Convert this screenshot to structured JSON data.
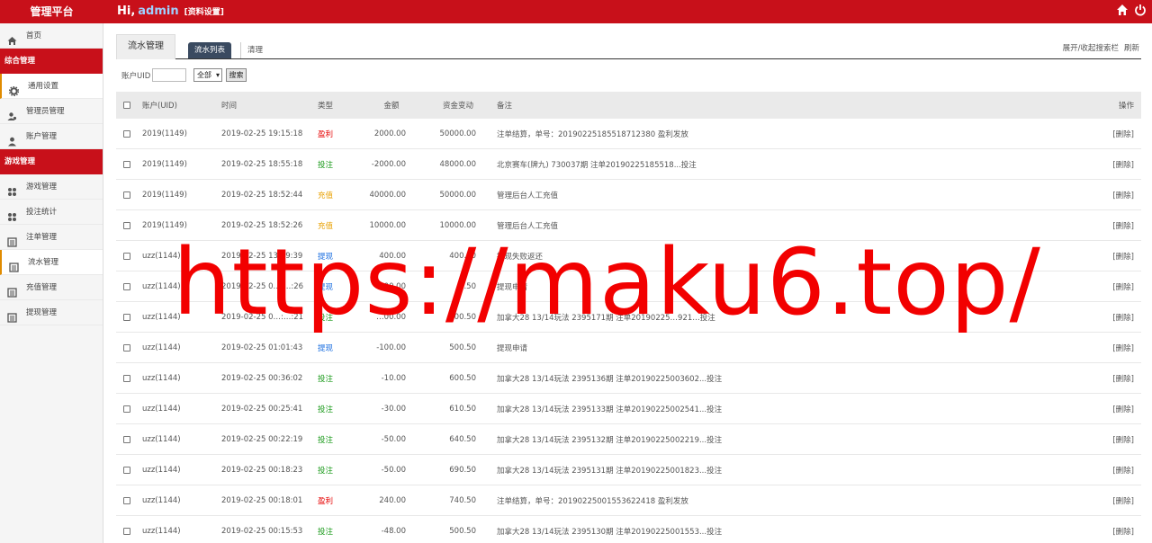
{
  "topbar": {
    "brand": "管理平台",
    "greeting": "Hi,",
    "username": "admin",
    "profile_link": "[资料设置]",
    "icons": [
      "home-icon",
      "power-icon"
    ]
  },
  "sidebar": {
    "items": [
      {
        "kind": "item",
        "label": "首页",
        "icon": "home-icon"
      },
      {
        "kind": "section",
        "label": "综合管理"
      },
      {
        "kind": "item",
        "label": "通用设置",
        "icon": "gear-icon",
        "active": true
      },
      {
        "kind": "item",
        "label": "管理员管理",
        "icon": "admin-user-icon"
      },
      {
        "kind": "item",
        "label": "账户管理",
        "icon": "user-icon"
      },
      {
        "kind": "section",
        "label": "游戏管理"
      },
      {
        "kind": "item",
        "label": "游戏管理",
        "icon": "game-icon"
      },
      {
        "kind": "item",
        "label": "投注统计",
        "icon": "stats-icon"
      },
      {
        "kind": "item",
        "label": "注单管理",
        "icon": "list-icon"
      },
      {
        "kind": "item",
        "label": "流水管理",
        "icon": "list-icon",
        "active": true
      },
      {
        "kind": "item",
        "label": "充值管理",
        "icon": "list-icon"
      },
      {
        "kind": "item",
        "label": "提现管理",
        "icon": "list-icon"
      }
    ]
  },
  "main": {
    "title_tab": "流水管理",
    "subtab_active": "流水列表",
    "subtab_clear": "清理",
    "toggle_search": "展开/收起搜索栏",
    "refresh": "刷新",
    "search": {
      "uid_label": "账户UID",
      "uid_value": "",
      "type_select": "全部",
      "search_button": "搜索"
    },
    "table": {
      "headers": {
        "uid": "账户(UID)",
        "time": "时间",
        "type": "类型",
        "amount": "金额",
        "change": "资金变动",
        "note": "备注",
        "op": "操作"
      },
      "type_colors": {
        "盈利": "#e60000",
        "投注": "#1a9a1a",
        "充值": "#e8a000",
        "提现": "#1a6ee0"
      },
      "rows": [
        {
          "uid": "2019(1149)",
          "time": "2019-02-25 19:15:18",
          "type": "盈利",
          "amount": "2000.00",
          "change": "50000.00",
          "note": "注单结算，单号：20190225185518712380 盈利发放",
          "op": "[删除]"
        },
        {
          "uid": "2019(1149)",
          "time": "2019-02-25 18:55:18",
          "type": "投注",
          "amount": "-2000.00",
          "change": "48000.00",
          "note": "北京赛车(牌九) 730037期 注单20190225185518...投注",
          "op": "[删除]"
        },
        {
          "uid": "2019(1149)",
          "time": "2019-02-25 18:52:44",
          "type": "充值",
          "amount": "40000.00",
          "change": "50000.00",
          "note": "管理后台人工充值",
          "op": "[删除]"
        },
        {
          "uid": "2019(1149)",
          "time": "2019-02-25 18:52:26",
          "type": "充值",
          "amount": "10000.00",
          "change": "10000.00",
          "note": "管理后台人工充值",
          "op": "[删除]"
        },
        {
          "uid": "uzz(1144)",
          "time": "2019-02-25 13:19:39",
          "type": "提现",
          "amount": "400.00",
          "change": "400.50",
          "note": "提现失败返还",
          "op": "[删除]"
        },
        {
          "uid": "uzz(1144)",
          "time": "2019-02-25 0…:…:26",
          "type": "提现",
          "amount": "-400.00",
          "change": "0.50",
          "note": "提现申请",
          "op": "[删除]"
        },
        {
          "uid": "uzz(1144)",
          "time": "2019-02-25 0…:…:21",
          "type": "投注",
          "amount": "…00.00",
          "change": "400.50",
          "note": "加拿大28 13/14玩法 2395171期 注单20190225…921…投注",
          "op": "[删除]"
        },
        {
          "uid": "uzz(1144)",
          "time": "2019-02-25 01:01:43",
          "type": "提现",
          "amount": "-100.00",
          "change": "500.50",
          "note": "提现申请",
          "op": "[删除]"
        },
        {
          "uid": "uzz(1144)",
          "time": "2019-02-25 00:36:02",
          "type": "投注",
          "amount": "-10.00",
          "change": "600.50",
          "note": "加拿大28 13/14玩法 2395136期 注单20190225003602...投注",
          "op": "[删除]"
        },
        {
          "uid": "uzz(1144)",
          "time": "2019-02-25 00:25:41",
          "type": "投注",
          "amount": "-30.00",
          "change": "610.50",
          "note": "加拿大28 13/14玩法 2395133期 注单20190225002541...投注",
          "op": "[删除]"
        },
        {
          "uid": "uzz(1144)",
          "time": "2019-02-25 00:22:19",
          "type": "投注",
          "amount": "-50.00",
          "change": "640.50",
          "note": "加拿大28 13/14玩法 2395132期 注单20190225002219...投注",
          "op": "[删除]"
        },
        {
          "uid": "uzz(1144)",
          "time": "2019-02-25 00:18:23",
          "type": "投注",
          "amount": "-50.00",
          "change": "690.50",
          "note": "加拿大28 13/14玩法 2395131期 注单20190225001823...投注",
          "op": "[删除]"
        },
        {
          "uid": "uzz(1144)",
          "time": "2019-02-25 00:18:01",
          "type": "盈利",
          "amount": "240.00",
          "change": "740.50",
          "note": "注单结算，单号：20190225001553622418 盈利发放",
          "op": "[删除]"
        },
        {
          "uid": "uzz(1144)",
          "time": "2019-02-25 00:15:53",
          "type": "投注",
          "amount": "-48.00",
          "change": "500.50",
          "note": "加拿大28 13/14玩法 2395130期 注单20190225001553...投注",
          "op": "[删除]"
        }
      ]
    }
  },
  "watermark": "https://maku6.top/"
}
